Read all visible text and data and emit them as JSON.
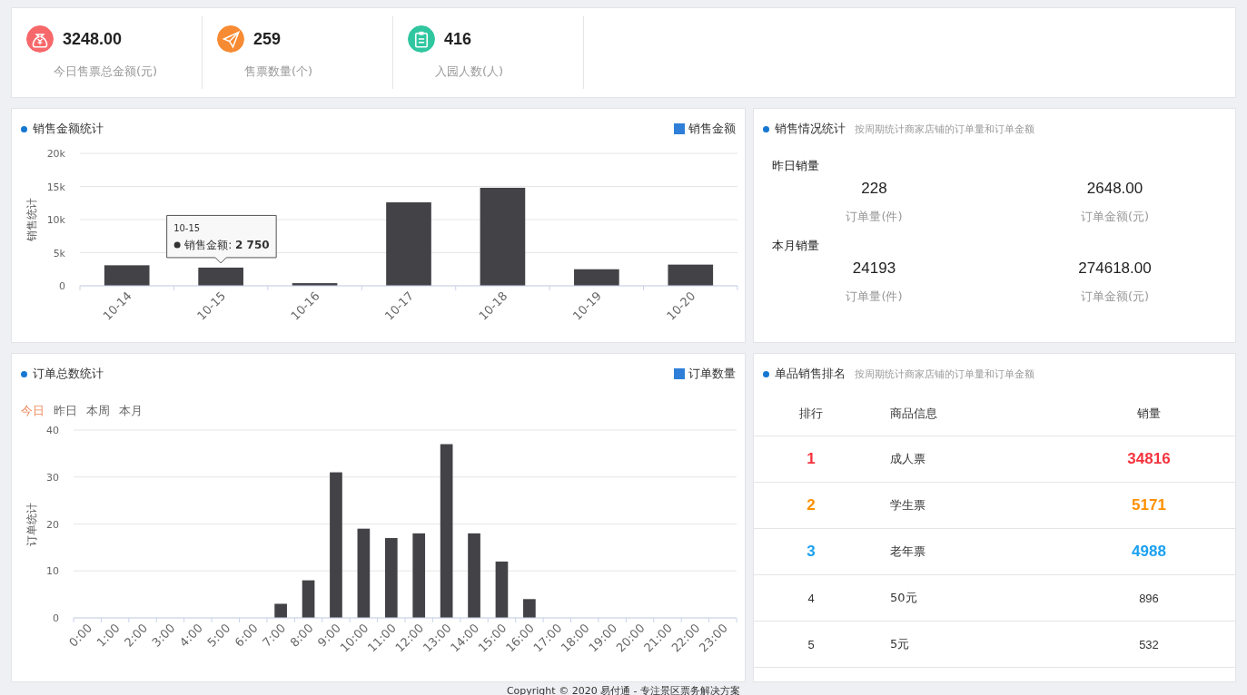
{
  "stats": [
    {
      "color": "#f7686b",
      "value": "3248.00",
      "label": "今日售票总金额(元)"
    },
    {
      "color": "#f78b33",
      "value": "259",
      "label": "售票数量(个)"
    },
    {
      "color": "#2fc6a0",
      "value": "416",
      "label": "入园人数(人)"
    }
  ],
  "sales_chart": {
    "title": "销售金额统计",
    "tooltip": {
      "title": "10-15",
      "label": "销售金额:",
      "value": "2 750"
    },
    "chart_data": {
      "type": "bar",
      "grid": true,
      "ylabel": "销售统计",
      "categories": [
        "10-14",
        "10-15",
        "10-16",
        "10-17",
        "10-18",
        "10-19",
        "10-20"
      ],
      "series": [
        {
          "name": "销售金额",
          "color": "#434247",
          "values": [
            3100,
            2750,
            400,
            12600,
            14800,
            2500,
            3200
          ]
        }
      ],
      "ylim": [
        0,
        20000
      ],
      "yticks": [
        {
          "value": 0,
          "label": "0"
        },
        {
          "value": 5000,
          "label": "5k"
        },
        {
          "value": 10000,
          "label": "10k"
        },
        {
          "value": 15000,
          "label": "15k"
        },
        {
          "value": 20000,
          "label": "20k"
        }
      ]
    }
  },
  "sales_summary": {
    "title": "销售情况统计",
    "subtitle": "按周期统计商家店铺的订单量和订单金额",
    "groups": [
      {
        "title": "昨日销量",
        "items": [
          {
            "value": "228",
            "label": "订单量(件)"
          },
          {
            "value": "2648.00",
            "label": "订单金额(元)"
          }
        ]
      },
      {
        "title": "本月销量",
        "items": [
          {
            "value": "24193",
            "label": "订单量(件)"
          },
          {
            "value": "274618.00",
            "label": "订单金额(元)"
          }
        ]
      }
    ]
  },
  "orders_chart": {
    "title": "订单总数统计",
    "tabs": [
      {
        "label": "今日",
        "selected": true
      },
      {
        "label": "昨日",
        "selected": false
      },
      {
        "label": "本周",
        "selected": false
      },
      {
        "label": "本月",
        "selected": false
      }
    ],
    "chart_data": {
      "type": "bar",
      "grid": true,
      "ylabel": "订单统计",
      "categories": [
        "0:00",
        "1:00",
        "2:00",
        "3:00",
        "4:00",
        "5:00",
        "6:00",
        "7:00",
        "8:00",
        "9:00",
        "10:00",
        "11:00",
        "12:00",
        "13:00",
        "14:00",
        "15:00",
        "16:00",
        "17:00",
        "18:00",
        "19:00",
        "20:00",
        "21:00",
        "22:00",
        "23:00"
      ],
      "series": [
        {
          "name": "订单数量",
          "color": "#434247",
          "values": [
            0,
            0,
            0,
            0,
            0,
            0,
            0,
            3,
            8,
            31,
            19,
            17,
            18,
            37,
            18,
            12,
            4,
            0,
            0,
            0,
            0,
            0,
            0,
            0
          ]
        }
      ],
      "ylim": [
        0,
        40
      ],
      "yticks": [
        0,
        10,
        20,
        30,
        40
      ]
    }
  },
  "ranking": {
    "title": "单品销售排名",
    "subtitle": "按周期统计商家店铺的订单量和订单金额",
    "columns": [
      "排行",
      "商品信息",
      "销量"
    ],
    "rows": [
      {
        "rank": "1",
        "name": "成人票",
        "sales": "34816",
        "color": "#f5333f"
      },
      {
        "rank": "2",
        "name": "学生票",
        "sales": "5171",
        "color": "#ff8f00"
      },
      {
        "rank": "3",
        "name": "老年票",
        "sales": "4988",
        "color": "#1ba1f0"
      },
      {
        "rank": "4",
        "name": "50元",
        "sales": "896"
      },
      {
        "rank": "5",
        "name": "5元",
        "sales": "532"
      }
    ]
  },
  "footer": "Copyright © 2020 易付通 - 专注景区票务解决方案"
}
